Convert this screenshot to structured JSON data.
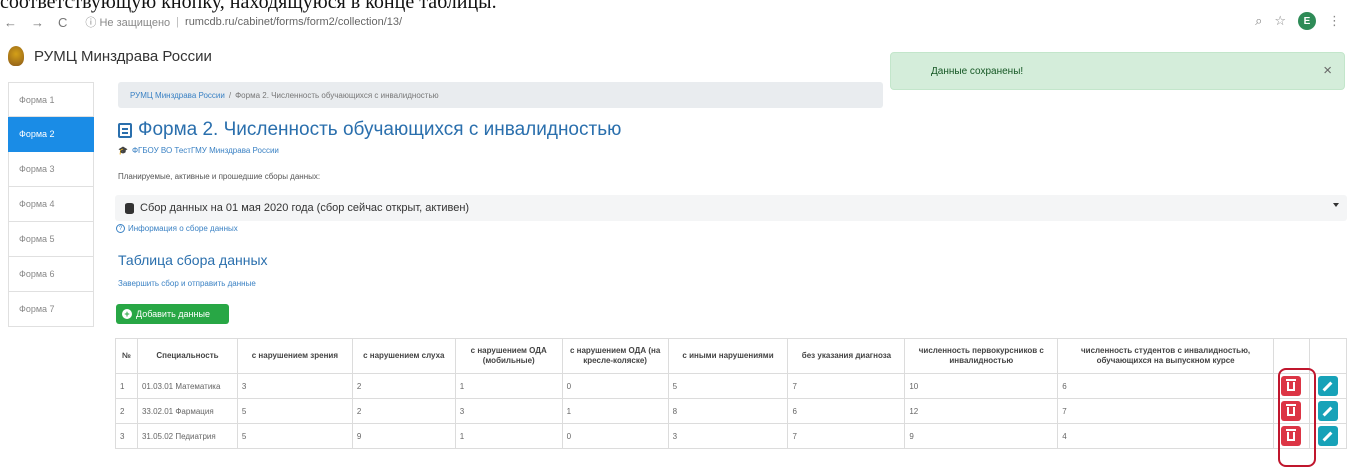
{
  "top_text": "соответствующую кнопку, находящуюся в конце таблицы.",
  "browser": {
    "back": "←",
    "forward": "→",
    "reload": "C",
    "security": "ⓘ Не защищено",
    "url": "rumcdb.ru/cabinet/forms/form2/collection/13/",
    "profile_letter": "E"
  },
  "brand": {
    "title": "РУМЦ Минздрава России"
  },
  "toast": {
    "message": "Данные сохранены!",
    "close": "×"
  },
  "sidebar": {
    "items": [
      {
        "label": "Форма 1",
        "active": false
      },
      {
        "label": "Форма 2",
        "active": true
      },
      {
        "label": "Форма 3",
        "active": false
      },
      {
        "label": "Форма 4",
        "active": false
      },
      {
        "label": "Форма 5",
        "active": false
      },
      {
        "label": "Форма 6",
        "active": false
      },
      {
        "label": "Форма 7",
        "active": false
      }
    ]
  },
  "breadcrumb": {
    "home": "РУМЦ Минздрава России",
    "separator": "/",
    "current": "Форма 2. Численность обучающихся с инвалидностью"
  },
  "page": {
    "title": "Форма 2. Численность обучающихся с инвалидностью",
    "organization": "ФГБОУ ВО ТестГМУ Минздрава России",
    "plan_label": "Планируемые, активные и прошедшие сборы данных:",
    "collection_select": "Сбор данных на 01 мая 2020 года (сбор сейчас открыт, активен)",
    "info_link": "Информация о сборе данных",
    "table_heading": "Таблица сбора данных",
    "finish_link": "Завершить сбор и отправить данные",
    "add_button": "Добавить данные"
  },
  "table": {
    "columns": [
      "№",
      "Специальность",
      "с нарушением зрения",
      "с нарушением слуха",
      "с нарушением ОДА (мобильные)",
      "с нарушением ОДА (на кресле-коляске)",
      "с иными нарушениями",
      "без указания диагноза",
      "численность первокурсников с инвалидностью",
      "численность студентов с инвалидностью, обучающихся на выпускном курсе"
    ],
    "rows": [
      [
        "1",
        "01.03.01 Математика",
        "3",
        "2",
        "1",
        "0",
        "5",
        "7",
        "10",
        "6"
      ],
      [
        "2",
        "33.02.01 Фармация",
        "5",
        "2",
        "3",
        "1",
        "8",
        "6",
        "12",
        "7"
      ],
      [
        "3",
        "31.05.02 Педиатрия",
        "5",
        "9",
        "1",
        "0",
        "3",
        "7",
        "9",
        "4"
      ]
    ]
  },
  "colors": {
    "accent": "#1a8ce6",
    "title": "#2a6fad",
    "success": "#28a745",
    "danger": "#dc3545",
    "info": "#17a2b8",
    "highlight": "#c0162d"
  }
}
